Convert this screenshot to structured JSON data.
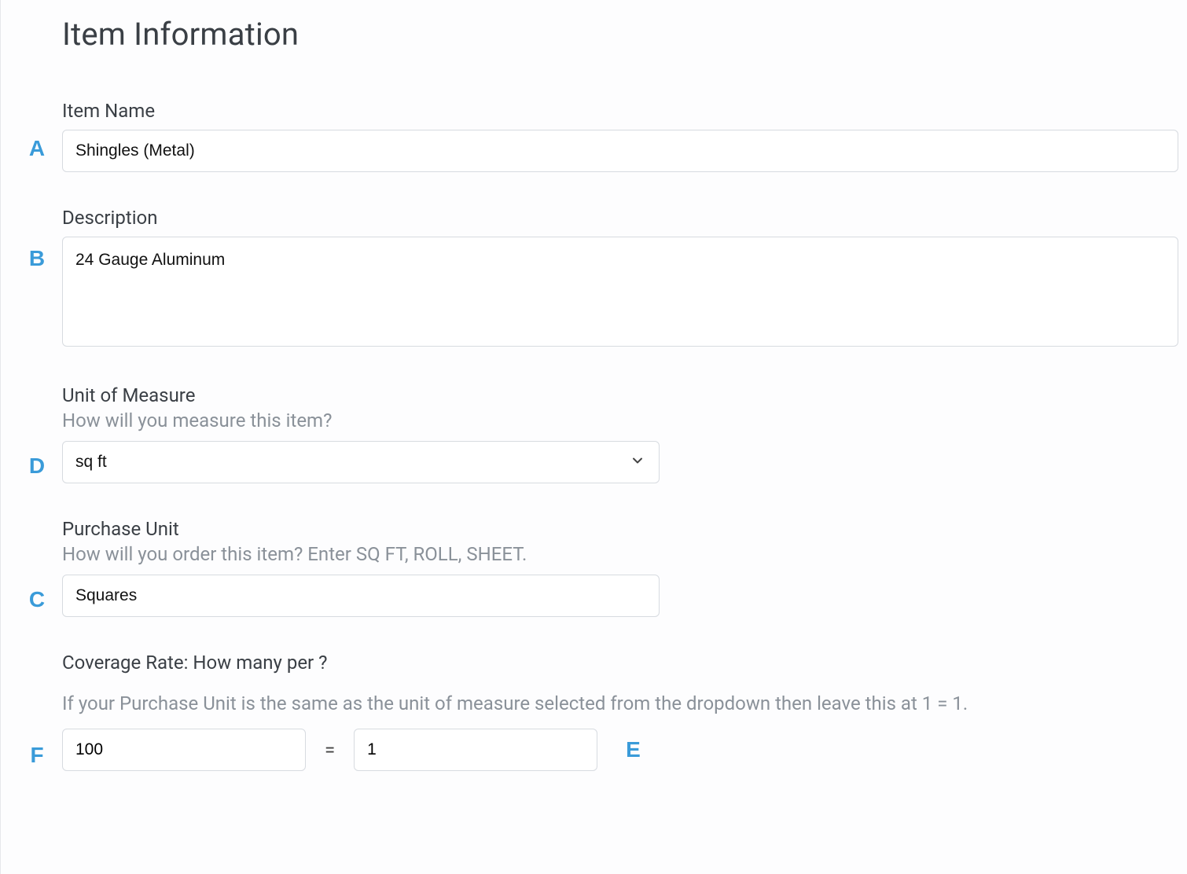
{
  "header": {
    "title": "Item Information"
  },
  "fields": {
    "item_name": {
      "label": "Item Name",
      "value": "Shingles (Metal)",
      "badge": "A"
    },
    "description": {
      "label": "Description",
      "value": "24 Gauge Aluminum",
      "badge": "B"
    },
    "unit_of_measure": {
      "label": "Unit of Measure",
      "help": "How will you measure this item?",
      "value": "sq ft",
      "badge": "D"
    },
    "purchase_unit": {
      "label": "Purchase Unit",
      "help": "How will you order this item? Enter SQ FT, ROLL, SHEET.",
      "value": "Squares",
      "badge": "C"
    },
    "coverage_rate": {
      "label": "Coverage Rate: How many per ?",
      "help": "If your Purchase Unit is the same as the unit of measure selected from the dropdown then leave this at 1 = 1.",
      "left_value": "100",
      "equals": "=",
      "right_value": "1",
      "badge_left": "F",
      "badge_right": "E"
    }
  }
}
